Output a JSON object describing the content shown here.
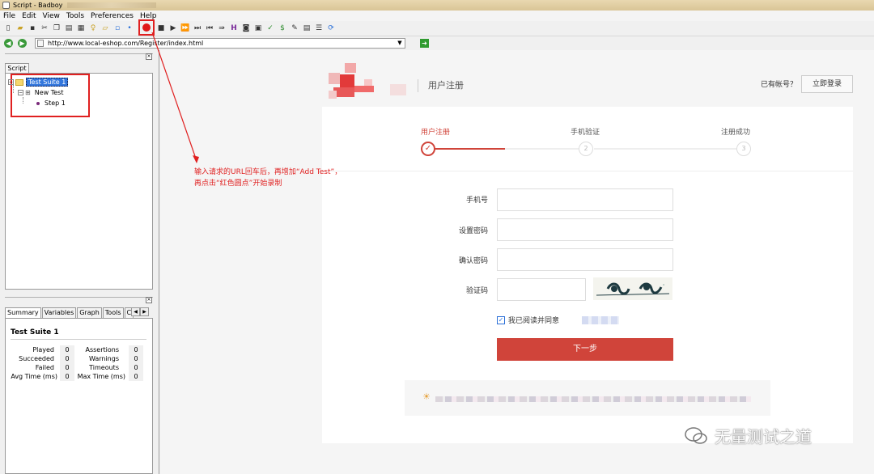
{
  "window": {
    "title": "Script - Badboy"
  },
  "menu": [
    "File",
    "Edit",
    "View",
    "Tools",
    "Preferences",
    "Help"
  ],
  "address": {
    "url": "http://www.local-eshop.com/Register/index.html"
  },
  "tree": {
    "tab": "Script",
    "suite": "Test Suite 1",
    "test": "New Test",
    "step": "Step 1"
  },
  "summary": {
    "tabs": [
      "Summary",
      "Variables",
      "Graph",
      "Tools",
      "C"
    ],
    "title": "Test Suite 1",
    "left_stats": [
      {
        "label": "Played",
        "value": "0"
      },
      {
        "label": "Succeeded",
        "value": "0"
      },
      {
        "label": "Failed",
        "value": "0"
      },
      {
        "label": "Avg Time (ms)",
        "value": "0"
      }
    ],
    "right_stats": [
      {
        "label": "Assertions",
        "value": "0"
      },
      {
        "label": "Warnings",
        "value": "0"
      },
      {
        "label": "Timeouts",
        "value": "0"
      },
      {
        "label": "Max Time (ms)",
        "value": "0"
      }
    ]
  },
  "page": {
    "heading": "用户注册",
    "has_account": "已有帐号？",
    "login": "立即登录",
    "steps": [
      {
        "label": "用户注册",
        "num": "✓"
      },
      {
        "label": "手机验证",
        "num": "2"
      },
      {
        "label": "注册成功",
        "num": "3"
      }
    ],
    "fields": [
      {
        "label": "手机号"
      },
      {
        "label": "设置密码"
      },
      {
        "label": "确认密码"
      },
      {
        "label": "验证码"
      }
    ],
    "agree": "我已阅读并同意",
    "next": "下一步"
  },
  "annotation": {
    "line1": "输入请求的URL回车后，再增加“Add Test”，",
    "line2": "再点击“红色圆点”开始录制"
  },
  "watermark": "无量测试之道",
  "colors": {
    "accent_red": "#d0443a",
    "annotation_red": "#e02020",
    "selection_blue": "#3377dd"
  }
}
